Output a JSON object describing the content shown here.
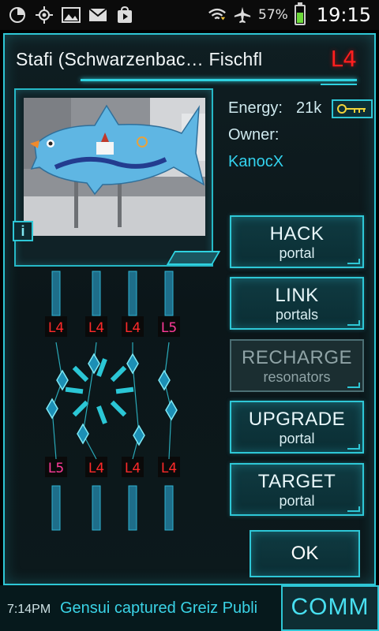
{
  "status_bar": {
    "icons": [
      "pie-chart-icon",
      "gps-icon",
      "gallery-icon",
      "gmail-icon",
      "play-store-icon"
    ],
    "wifi_icon": "wifi-icon",
    "airplane_icon": "airplane-icon",
    "battery_percent": "57%",
    "battery_level": 0.57,
    "time": "19:15"
  },
  "portal": {
    "name": "Stafi (Schwarzenbac… Fischfl",
    "level": "L4",
    "energy_label": "Energy:",
    "energy_value": "21k",
    "owner_label": "Owner:",
    "owner_name": "KanocX",
    "info_button": "i"
  },
  "actions": {
    "hack": {
      "main": "HACK",
      "sub": "portal"
    },
    "link": {
      "main": "LINK",
      "sub": "portals"
    },
    "recharge": {
      "main": "RECHARGE",
      "sub": "resonators"
    },
    "upgrade": {
      "main": "UPGRADE",
      "sub": "portal"
    },
    "target": {
      "main": "TARGET",
      "sub": "portal"
    },
    "ok": "OK"
  },
  "resonators": {
    "top": [
      "L4",
      "L4",
      "L4",
      "L5"
    ],
    "bottom": [
      "L5",
      "L4",
      "L4",
      "L4"
    ],
    "colors": {
      "L4": "#ff2a2a",
      "L5": "#ff3b9a"
    }
  },
  "comm": {
    "time": "7:14PM",
    "message": "Gensui captured Greiz Publi",
    "button": "COMM"
  },
  "colors": {
    "accent": "#2ec7d6",
    "owner": "#33d3ef",
    "level_badge": "#ff1f1f"
  }
}
